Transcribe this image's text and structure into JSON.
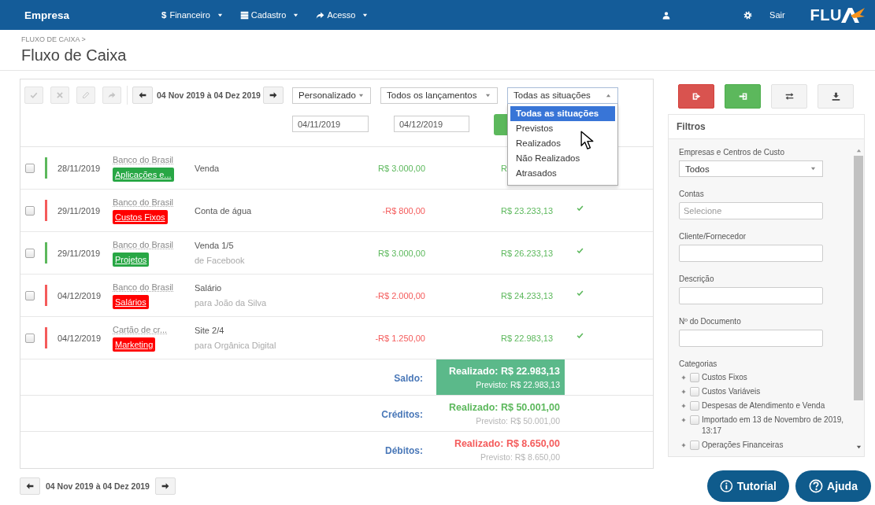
{
  "navbar": {
    "brand": "Empresa",
    "menus": [
      {
        "kind": "dollar",
        "glyph": "$",
        "label": "Financeiro"
      },
      {
        "kind": "database",
        "label": "Cadastro"
      },
      {
        "kind": "share",
        "label": "Acesso"
      }
    ],
    "logout": "Sair",
    "logo": "FLU"
  },
  "header": {
    "breadcrumb": "FLUXO DE CAIXA >",
    "title": "Fluxo de Caixa"
  },
  "toolbar": {
    "actions": [
      {
        "kind": "check",
        "disabled": true
      },
      {
        "kind": "close",
        "disabled": true
      },
      {
        "kind": "pencil",
        "disabled": true
      },
      {
        "kind": "share",
        "disabled": true
      }
    ],
    "period": "04 Nov 2019 à 04 Dez 2019",
    "selects": [
      {
        "value": "Personalizado",
        "expanded": false
      },
      {
        "value": "Todos os lançamentos",
        "expanded": false
      },
      {
        "value": "Todas as situações",
        "expanded": true,
        "options": [
          {
            "label": "Todas as situações",
            "selected": true
          },
          {
            "label": "Previstos",
            "selected": false
          },
          {
            "label": "Realizados",
            "selected": false
          },
          {
            "label": "Não Realizados",
            "selected": false
          },
          {
            "label": "Atrasados",
            "selected": false
          }
        ]
      }
    ],
    "date_from": "04/11/2019",
    "date_to": "04/12/2019"
  },
  "entries": [
    {
      "selected": false,
      "kind": "credit",
      "date": "28/11/2019",
      "account": "Banco do Brasil",
      "tag": "Aplicações e...",
      "color": "#28a745",
      "description": "Venda",
      "amount": "R$ 3.000,00",
      "balance": "R"
    },
    {
      "selected": false,
      "kind": "debit",
      "date": "29/11/2019",
      "account": "Banco do Brasil",
      "tag": "Custos Fixos",
      "color": "#ff0000",
      "description": "Conta de água",
      "amount": "-R$ 800,00",
      "balance": "R$ 23.233,13",
      "reconciled": true
    },
    {
      "selected": false,
      "kind": "credit",
      "date": "29/11/2019",
      "account": "Banco do Brasil",
      "tag": "Projetos",
      "color": "#28a745",
      "description": "Venda 1/5",
      "note": "de Facebook",
      "amount": "R$ 3.000,00",
      "balance": "R$ 26.233,13",
      "reconciled": true
    },
    {
      "selected": false,
      "kind": "debit",
      "date": "04/12/2019",
      "account": "Banco do Brasil",
      "tag": "Salários",
      "color": "#ff0000",
      "description": "Salário",
      "note": "para João da Silva",
      "amount": "-R$ 2.000,00",
      "balance": "R$ 24.233,13",
      "reconciled": true
    },
    {
      "selected": false,
      "kind": "debit",
      "date": "04/12/2019",
      "account": "Cartão de cr...",
      "tag": "Marketing",
      "color": "#ff0000",
      "description": "Site 2/4",
      "note": "para Orgânica Digital",
      "amount": "-R$ 1.250,00",
      "balance": "R$ 22.983,13",
      "reconciled": true
    }
  ],
  "totals": [
    {
      "kind": "saldo",
      "label": "Saldo:",
      "realized": "Realizado: R$ 22.983,13",
      "forecast": "Previsto: R$ 22.983,13"
    },
    {
      "kind": "credit",
      "label": "Créditos:",
      "realized": "Realizado: R$ 50.001,00",
      "forecast": "Previsto: R$ 50.001,00"
    },
    {
      "kind": "debit",
      "label": "Débitos:",
      "realized": "Realizado: R$ 8.650,00",
      "forecast": "Previsto: R$ 8.650,00"
    }
  ],
  "pager": {
    "period": "04 Nov 2019 à 04 Dez 2019"
  },
  "sidebar": {
    "actions": [
      {
        "kind": "exit"
      },
      {
        "kind": "enter"
      },
      {
        "kind": "transfer"
      },
      {
        "kind": "import"
      }
    ],
    "title": "Filtros",
    "fields": [
      {
        "kind": "select",
        "label": "Empresas e Centros de Custo",
        "value": "Todos"
      },
      {
        "kind": "input",
        "label": "Contas",
        "placeholder": "Selecione"
      },
      {
        "kind": "input",
        "label": "Cliente/Fornecedor"
      },
      {
        "kind": "input",
        "label": "Descrição"
      },
      {
        "kind": "input",
        "label": "Nº do Documento"
      }
    ],
    "categories_label": "Categorias",
    "categories": [
      {
        "label": "Custos Fixos",
        "checked": false,
        "expanded": false
      },
      {
        "label": "Custos Variáveis",
        "checked": false,
        "expanded": false
      },
      {
        "label": "Despesas de Atendimento e Venda",
        "checked": false,
        "expanded": false
      },
      {
        "label": "Importado em 13 de Novembro de 2019, 13:17",
        "checked": false,
        "expanded": false
      },
      {
        "label": "Operações Financeiras",
        "checked": false,
        "expanded": false
      }
    ]
  },
  "help_buttons": [
    {
      "kind": "info",
      "label": "Tutorial"
    },
    {
      "kind": "question",
      "label": "Ajuda"
    }
  ]
}
